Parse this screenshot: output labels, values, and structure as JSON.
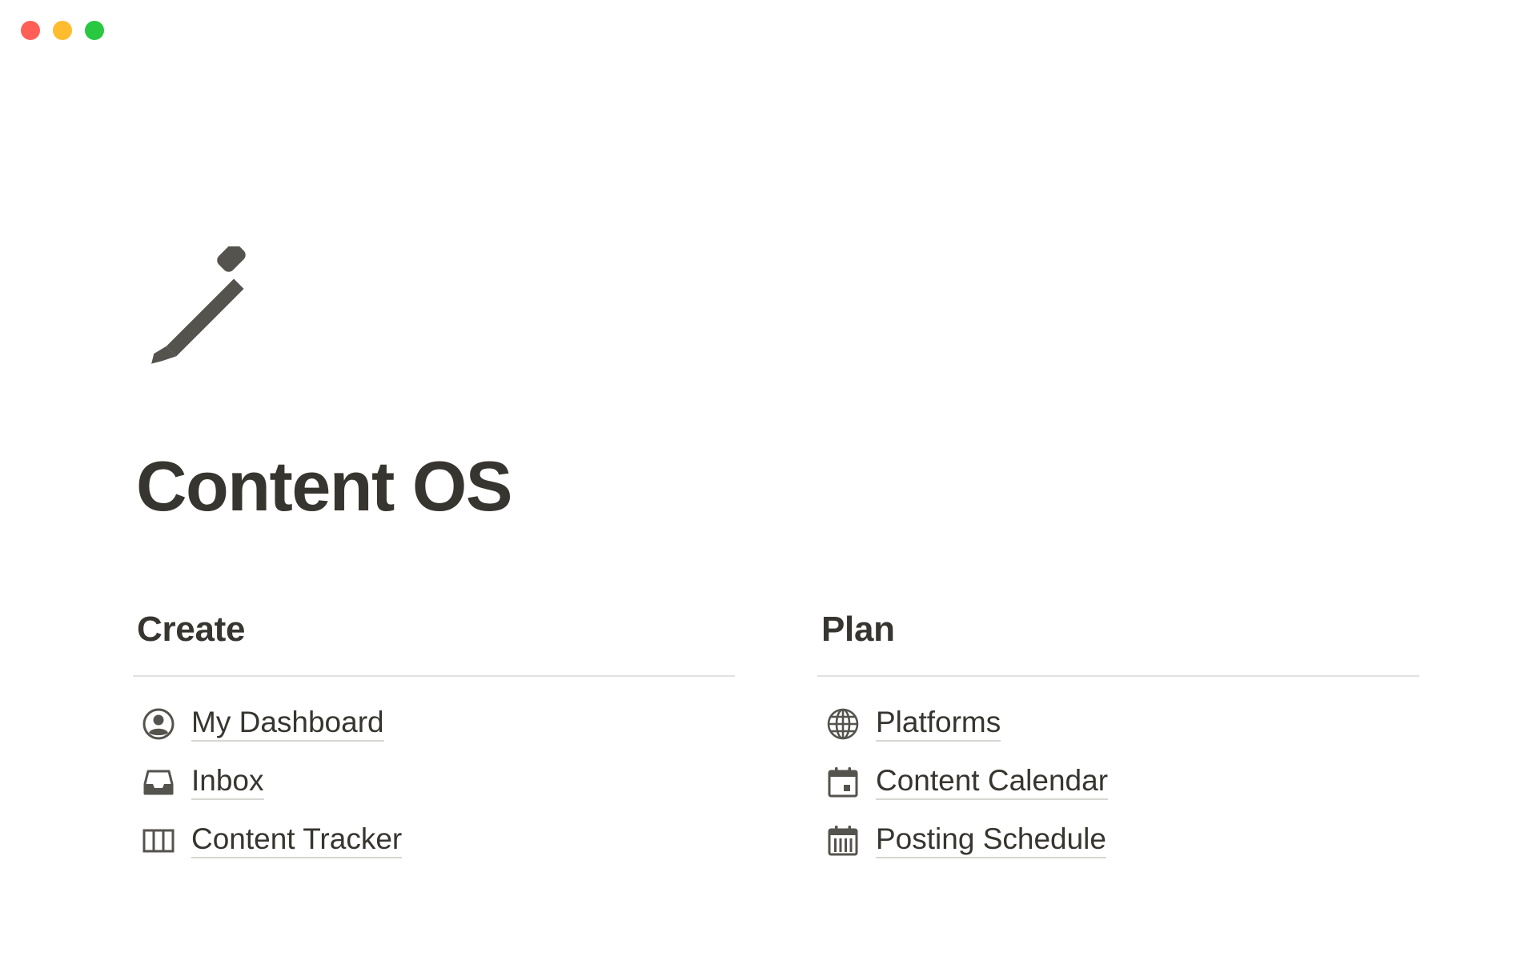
{
  "window": {
    "controls": [
      {
        "name": "close",
        "color": "#ff5f57"
      },
      {
        "name": "minimize",
        "color": "#febc2e"
      },
      {
        "name": "maximize",
        "color": "#28c840"
      }
    ]
  },
  "page": {
    "icon": "pencil-icon",
    "title": "Content OS"
  },
  "sections": {
    "create": {
      "heading": "Create",
      "links": [
        {
          "label": "My Dashboard",
          "icon": "user-circle-icon"
        },
        {
          "label": "Inbox",
          "icon": "inbox-tray-icon"
        },
        {
          "label": "Content Tracker",
          "icon": "board-columns-icon"
        }
      ]
    },
    "plan": {
      "heading": "Plan",
      "links": [
        {
          "label": "Platforms",
          "icon": "globe-icon"
        },
        {
          "label": "Content Calendar",
          "icon": "calendar-day-icon"
        },
        {
          "label": "Posting Schedule",
          "icon": "calendar-week-icon"
        }
      ]
    }
  },
  "colors": {
    "text": "#37352f",
    "icon": "#55534e",
    "divider": "#e3e2e0",
    "link_underline": "#d7d6d3"
  }
}
